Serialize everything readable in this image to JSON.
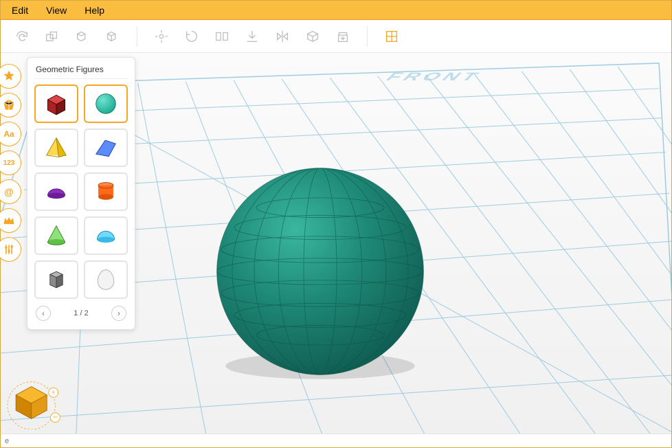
{
  "menu": {
    "items": [
      "Edit",
      "View",
      "Help"
    ]
  },
  "toolbar": {
    "buttons": [
      "redo",
      "cubes-group",
      "cube-single",
      "cube-outline",
      "sep",
      "snap",
      "rotate-tool",
      "flip-tool",
      "download",
      "mirror",
      "box-fill",
      "export-bin",
      "sep",
      "grid-toggle"
    ]
  },
  "rail": {
    "buttons": [
      {
        "name": "star-tool",
        "icon": "star"
      },
      {
        "name": "polyhedron-tool",
        "icon": "poly"
      },
      {
        "name": "text-tool",
        "icon": "Aa"
      },
      {
        "name": "number-tool",
        "icon": "123"
      },
      {
        "name": "symbol-tool",
        "icon": "@"
      },
      {
        "name": "crown-tool",
        "icon": "crown"
      },
      {
        "name": "sliders-tool",
        "icon": "sliders"
      }
    ]
  },
  "panel": {
    "title": "Geometric Figures",
    "shapes": [
      {
        "name": "cube",
        "active": true
      },
      {
        "name": "sphere",
        "active": true
      },
      {
        "name": "pyramid",
        "active": false
      },
      {
        "name": "prism",
        "active": false
      },
      {
        "name": "half-dome",
        "active": false
      },
      {
        "name": "cylinder",
        "active": false
      },
      {
        "name": "cone",
        "active": false
      },
      {
        "name": "hemisphere",
        "active": false
      },
      {
        "name": "hex-prism",
        "active": false
      },
      {
        "name": "egg",
        "active": false
      }
    ],
    "pager": {
      "label": "1 / 2"
    }
  },
  "viewport": {
    "front_label": "FRONT",
    "placed_object": "sphere",
    "object_color": "#1f8a78"
  },
  "statusbar": {
    "text": "e"
  }
}
